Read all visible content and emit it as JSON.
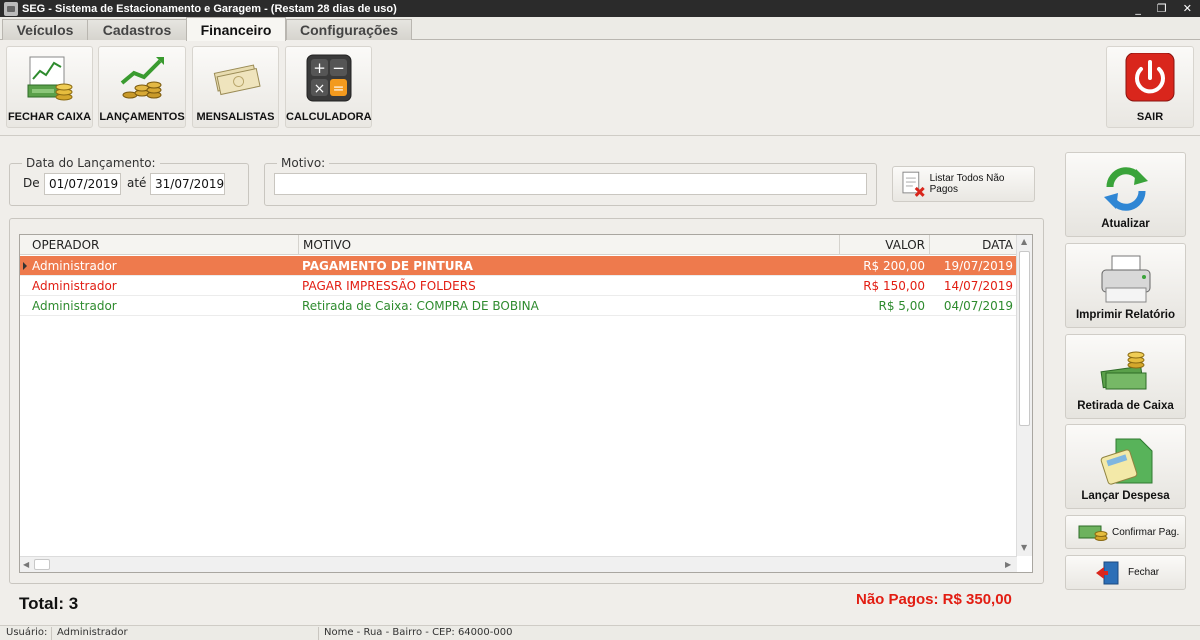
{
  "window": {
    "title": "SEG - Sistema de Estacionamento e Garagem  - (Restam 28 dias de uso)",
    "minimize": "_",
    "restore": "❐",
    "close": "✕"
  },
  "tabs": [
    {
      "label": "Veículos",
      "active": false
    },
    {
      "label": "Cadastros",
      "active": false
    },
    {
      "label": "Financeiro",
      "active": true
    },
    {
      "label": "Configurações",
      "active": false
    }
  ],
  "toolbar": {
    "fechar_caixa": {
      "label": "FECHAR CAIXA",
      "icon": "cash-register-chart-icon"
    },
    "lancamentos": {
      "label": "LANÇAMENTOS",
      "icon": "coins-growth-icon"
    },
    "mensalistas": {
      "label": "MENSALISTAS",
      "icon": "money-notes-icon"
    },
    "calculadora": {
      "label": "CALCULADORA",
      "icon": "calculator-icon"
    },
    "sair": {
      "label": "SAIR",
      "icon": "power-icon"
    }
  },
  "filters": {
    "data_legend": "Data do Lançamento:",
    "de_label": "De",
    "de_value": "01/07/2019",
    "ate_label": "até",
    "ate_value": "31/07/2019",
    "motivo_legend": "Motivo:",
    "motivo_value": "",
    "listar_label": "Listar Todos Não Pagos"
  },
  "grid": {
    "columns": [
      "OPERADOR",
      "MOTIVO",
      "VALOR",
      "DATA"
    ],
    "rows": [
      {
        "operador": "Administrador",
        "motivo": "PAGAMENTO DE PINTURA",
        "valor": "R$ 200,00",
        "data": "19/07/2019",
        "color": "#ffffff",
        "selected": true
      },
      {
        "operador": "Administrador",
        "motivo": "PAGAR IMPRESSÃO FOLDERS",
        "valor": "R$ 150,00",
        "data": "14/07/2019",
        "color": "#e21d12",
        "selected": false
      },
      {
        "operador": "Administrador",
        "motivo": "Retirada de Caixa: COMPRA DE BOBINA",
        "valor": "R$ 5,00",
        "data": "04/07/2019",
        "color": "#2e8b2e",
        "selected": false
      }
    ]
  },
  "totals": {
    "total": "Total: 3",
    "nao_pagos": "Não Pagos: R$ 350,00"
  },
  "side": {
    "atualizar": "Atualizar",
    "imprimir": "Imprimir Relatório",
    "retirada": "Retirada de Caixa",
    "despesa": "Lançar Despesa",
    "confirmar": "Confirmar Pag.",
    "fechar": "Fechar"
  },
  "status": {
    "usuario_label": "Usuário:",
    "usuario_value": "Administrador",
    "endereco": "Nome - Rua - Bairro - CEP: 64000-000"
  },
  "colors": {
    "selected_row": "#ee7a4d",
    "paid_text": "#2e8b2e",
    "unpaid_text": "#e21d12"
  }
}
